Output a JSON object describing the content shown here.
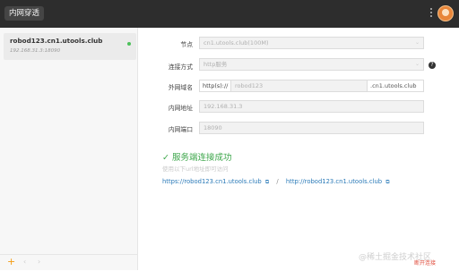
{
  "app": {
    "title": "内网穿透"
  },
  "sidebar": {
    "hosts": [
      {
        "name": "robod123.cn1.utools.club",
        "ip": "192.168.31.3:18090"
      }
    ],
    "bottom": {
      "add": "+",
      "left": "‹",
      "right": "›"
    }
  },
  "form": {
    "node": {
      "label": "节点",
      "value": "cn1.utools.club(100M)"
    },
    "connection": {
      "label": "连接方式",
      "value": "http服务"
    },
    "domain": {
      "label": "外网域名",
      "scheme": "http(s)://",
      "subdomain": "robod123",
      "suffix": ".cn1.utools.club"
    },
    "address": {
      "label": "内网地址",
      "value": "192.168.31.3"
    },
    "port": {
      "label": "内网端口",
      "value": "18090"
    }
  },
  "status": {
    "title": "服务端连接成功",
    "hint": "使用以下url地址即可访问",
    "urls": [
      "https://robod123.cn1.utools.club",
      "http://robod123.cn1.utools.club"
    ],
    "separator": "/"
  },
  "footer": {
    "watermark": "@稀土掘金技术社区",
    "badge": "断开连接"
  },
  "colors": {
    "titlebar": "#2d2d2d",
    "success": "#3ca64a",
    "link": "#2a7ab8",
    "accent": "#f39c12"
  }
}
